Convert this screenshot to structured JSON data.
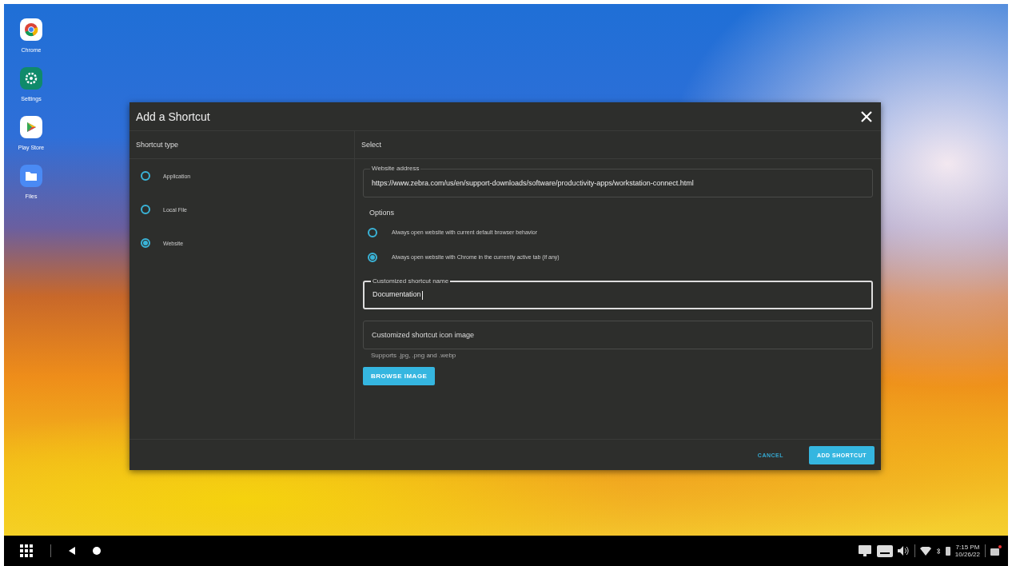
{
  "desktop_icons": [
    {
      "kind": "chrome",
      "label": "Chrome"
    },
    {
      "kind": "settings",
      "label": "Settings"
    },
    {
      "kind": "play",
      "label": "Play Store"
    },
    {
      "kind": "files",
      "label": "Files"
    }
  ],
  "dialog": {
    "title": "Add a Shortcut",
    "shortcut_type": {
      "heading": "Shortcut type",
      "options": [
        {
          "label": "Application",
          "selected": false
        },
        {
          "label": "Local File",
          "selected": false
        },
        {
          "label": "Website",
          "selected": true
        }
      ]
    },
    "select": {
      "heading": "Select",
      "website_address": {
        "label": "Website address",
        "value": "https://www.zebra.com/us/en/support-downloads/software/productivity-apps/workstation-connect.html"
      },
      "options_heading": "Options",
      "options": [
        {
          "label": "Always open website with current default browser behavior",
          "selected": false
        },
        {
          "label": "Always open website with Chrome in the currently active tab (if any)",
          "selected": true
        }
      ],
      "shortcut_name": {
        "label": "Customized shortcut name",
        "value": "Documentation"
      },
      "icon_image": {
        "placeholder": "Customized shortcut icon image",
        "hint": "Supports .jpg, .png and .webp"
      },
      "browse_button": "BROWSE IMAGE"
    },
    "buttons": [
      {
        "kind": "text",
        "label": "CANCEL"
      },
      {
        "kind": "filled",
        "label": "ADD SHORTCUT"
      }
    ]
  },
  "taskbar": {
    "time": "7:15 PM",
    "date": "10/26/22"
  }
}
